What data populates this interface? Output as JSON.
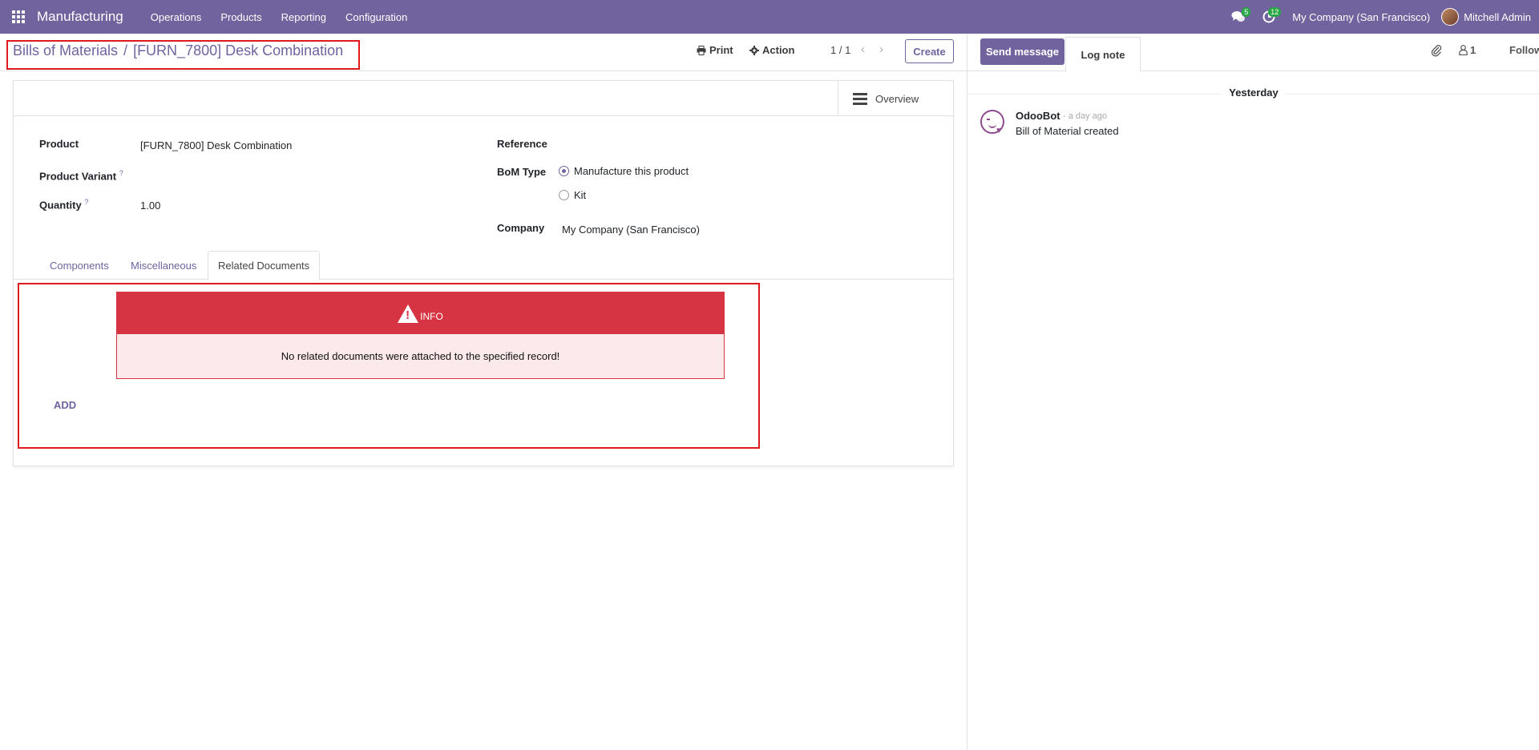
{
  "navbar": {
    "app_name": "Manufacturing",
    "menu": [
      "Operations",
      "Products",
      "Reporting",
      "Configuration"
    ],
    "messages_count": "5",
    "activities_count": "12",
    "company": "My Company (San Francisco)",
    "user": "Mitchell Admin"
  },
  "breadcrumb": {
    "parent": "Bills of Materials",
    "separator": "/",
    "current": "[FURN_7800] Desk Combination"
  },
  "control": {
    "print_label": "Print",
    "action_label": "Action",
    "pager": "1 / 1",
    "create_label": "Create"
  },
  "form": {
    "overview_label": "Overview",
    "product_label": "Product",
    "product_value": "[FURN_7800] Desk Combination",
    "variant_label": "Product Variant",
    "quantity_label": "Quantity",
    "quantity_value": "1.00",
    "help_mark": "?",
    "reference_label": "Reference",
    "bom_type_label": "BoM Type",
    "bom_type_options": [
      "Manufacture this product",
      "Kit"
    ],
    "bom_type_selected": "Manufacture this product",
    "company_label": "Company",
    "company_value": "My Company (San Francisco)"
  },
  "tabs": [
    "Components",
    "Miscellaneous",
    "Related Documents"
  ],
  "active_tab": "Related Documents",
  "alert": {
    "title": "INFO",
    "message": "No related documents were attached to the specified record!"
  },
  "add_label": "ADD",
  "chatter": {
    "send_message": "Send message",
    "log_note": "Log note",
    "followers_count": "1",
    "follow_label": "Follow",
    "day_separator": "Yesterday",
    "message": {
      "author": "OdooBot",
      "time": "- a day ago",
      "body": "Bill of Material created"
    }
  },
  "colors": {
    "primary": "#71639e",
    "danger": "#d63343",
    "highlight_box": "#e0191c"
  }
}
